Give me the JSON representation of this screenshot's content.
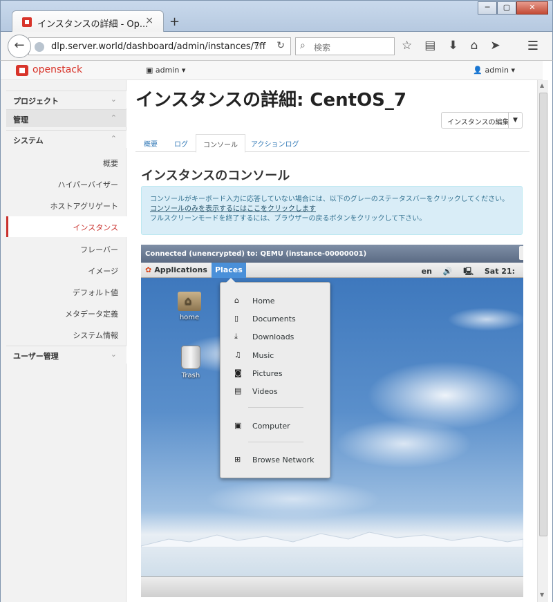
{
  "browser": {
    "tab_title": "インスタンスの詳細 - Op...",
    "close_glyph": "×",
    "newtab_glyph": "+",
    "window_buttons": [
      "─",
      "▢",
      "✕"
    ],
    "url": "dlp.server.world/dashboard/admin/instances/7ff",
    "search_placeholder": "検索"
  },
  "topnav": {
    "logo": "openstack",
    "project": "admin ▾",
    "user": "admin ▾"
  },
  "sidebar": {
    "project_header": "プロジェクト",
    "admin_header": "管理",
    "system_header": "システム",
    "items": [
      "概要",
      "ハイパーバイザー",
      "ホストアグリゲート",
      "インスタンス",
      "フレーバー",
      "イメージ",
      "デフォルト値",
      "メタデータ定義",
      "システム情報"
    ],
    "user_header": "ユーザー管理",
    "chevron_down": "⌄",
    "chevron_up": "⌃"
  },
  "main": {
    "title": "インスタンスの詳細: CentOS_7",
    "edit_button": "インスタンスの編集",
    "tabs": [
      "概要",
      "ログ",
      "コンソール",
      "アクションログ"
    ],
    "section_title": "インスタンスのコンソール",
    "alert_line1": "コンソールがキーボード入力に応答していない場合には、以下のグレーのステータスバーをクリックしてください。",
    "alert_link": "コンソールのみを表示するにはここをクリックします",
    "alert_line2": "フルスクリーンモードを終了するには、ブラウザーの戻るボタンをクリックして下さい。"
  },
  "console": {
    "status": "Connected (unencrypted) to: QEMU (instance-00000001)",
    "applications": "Applications",
    "places": "Places",
    "lang": "en",
    "volume": "🔊",
    "network": "🖳",
    "clock": "Sat 21:",
    "desktop_icons": [
      "home",
      "Trash"
    ],
    "places_menu": [
      "Home",
      "Documents",
      "Downloads",
      "Music",
      "Pictures",
      "Videos",
      "Computer",
      "Browse Network"
    ],
    "menu_icons": [
      "⌂",
      "▯",
      "⤓",
      "♫",
      "◙",
      "▤",
      "▣",
      "⊞"
    ]
  },
  "colors": {
    "accent": "#c9302c",
    "link": "#337ab7",
    "places_highlight": "#4a90d9"
  }
}
